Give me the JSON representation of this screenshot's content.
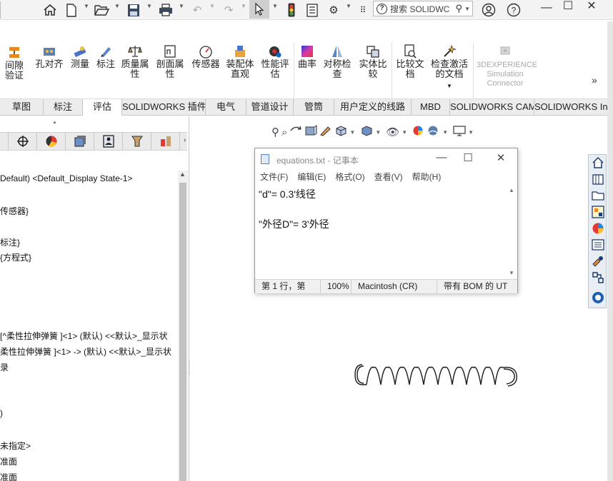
{
  "quick_access": {
    "icons": [
      "home-icon",
      "new-document-icon",
      "open-icon",
      "save-icon",
      "print-icon",
      "undo-icon",
      "redo-icon",
      "select-pointer-icon",
      "rebuild-traffic-light-icon",
      "file-properties-icon",
      "options-gear-icon",
      "fluent-ui-icon"
    ],
    "search_placeholder": "搜索 SOLIDWC",
    "help_symbol": "?"
  },
  "ribbon": {
    "buttons": [
      {
        "label": "间隙验证",
        "icon": "clearance-verification-icon"
      },
      {
        "label": "孔对齐",
        "icon": "hole-alignment-icon"
      },
      {
        "label": "测量",
        "icon": "measure-icon"
      },
      {
        "label": "标注",
        "icon": "markup-icon"
      },
      {
        "label": "质量属性",
        "icon": "mass-properties-icon"
      },
      {
        "label": "剖面属性",
        "icon": "section-properties-icon"
      },
      {
        "label": "传感器",
        "icon": "sensor-icon"
      },
      {
        "label": "装配体直观",
        "icon": "assemblyxpert-icon"
      },
      {
        "label": "性能评估",
        "icon": "performance-evaluation-icon"
      },
      {
        "label": "曲率",
        "icon": "curvature-icon"
      },
      {
        "label": "对称检查",
        "icon": "symmetry-check-icon"
      },
      {
        "label": "实体比较",
        "icon": "compare-bodies-icon"
      },
      {
        "label": "比较文档",
        "icon": "compare-documents-icon"
      },
      {
        "label": "检查激活的文档",
        "icon": "check-active-document-icon"
      }
    ],
    "disabled_button": "3DEXPERIENCE Simulation Connector"
  },
  "tabs": [
    {
      "label": "草图",
      "active": false
    },
    {
      "label": "标注",
      "active": false
    },
    {
      "label": "评估",
      "active": true
    },
    {
      "label": "SOLIDWORKS 插件",
      "active": false
    },
    {
      "label": "电气",
      "active": false
    },
    {
      "label": "管道设计",
      "active": false
    },
    {
      "label": "管筒",
      "active": false
    },
    {
      "label": "用户定义的线路",
      "active": false
    },
    {
      "label": "MBD",
      "active": false
    },
    {
      "label": "SOLIDWORKS CAM",
      "active": false
    },
    {
      "label": "SOLIDWORKS In...",
      "active": false
    }
  ],
  "panel_tabs": [
    "feature-manager-icon",
    "property-manager-icon",
    "configuration-manager-icon",
    "dimxpert-icon",
    "display-manager-icon",
    "cam-feature-icon",
    "cam-operation-icon"
  ],
  "tree": [
    "Default) <Default_Display State-1>",
    "",
    "传感器}",
    "",
    "标注}",
    "{方程式}",
    "",
    "",
    "",
    "[^柔性拉伸弹簧 ]<1> (默认) <<默认>_显示状",
    "柔性拉伸弹簧 ]<1> -> (默认) <<默认>_显示状",
    "录",
    "",
    ")",
    "",
    "未指定>",
    "准面",
    "准面"
  ],
  "notepad": {
    "title": "equations.txt - 记事本",
    "menu": [
      "文件(F)",
      "编辑(E)",
      "格式(O)",
      "查看(V)",
      "帮助(H)"
    ],
    "lines": [
      "\"d\"= 0.3'线径",
      "",
      "\"外径D\"= 3'外径"
    ],
    "status": {
      "position": "第 1 行，第",
      "zoom": "100%",
      "line_ending": "Macintosh (CR)",
      "encoding": "带有 BOM 的 UT"
    }
  },
  "heads_up_toolbar": [
    "zoom-to-fit-icon",
    "zoom-to-area-icon",
    "previous-view-icon",
    "section-view-icon",
    "dynamic-annotation-view-icon",
    "view-orientation-icon",
    "display-style-icon",
    "hide-show-items-icon",
    "edit-appearance-icon",
    "apply-scene-icon",
    "view-settings-icon"
  ],
  "task_pane": [
    "solidworks-resources-icon",
    "design-library-icon",
    "file-explorer-icon",
    "view-palette-icon",
    "appearances-scenes-icon",
    "custom-properties-icon",
    "toolbox-icon",
    "3d-interconnect-icon",
    "3dexperience-icon"
  ],
  "colors": {
    "accent": "#1f5fb5",
    "tab_bar": "#ececec",
    "status_bar": "#f0f0f0"
  }
}
